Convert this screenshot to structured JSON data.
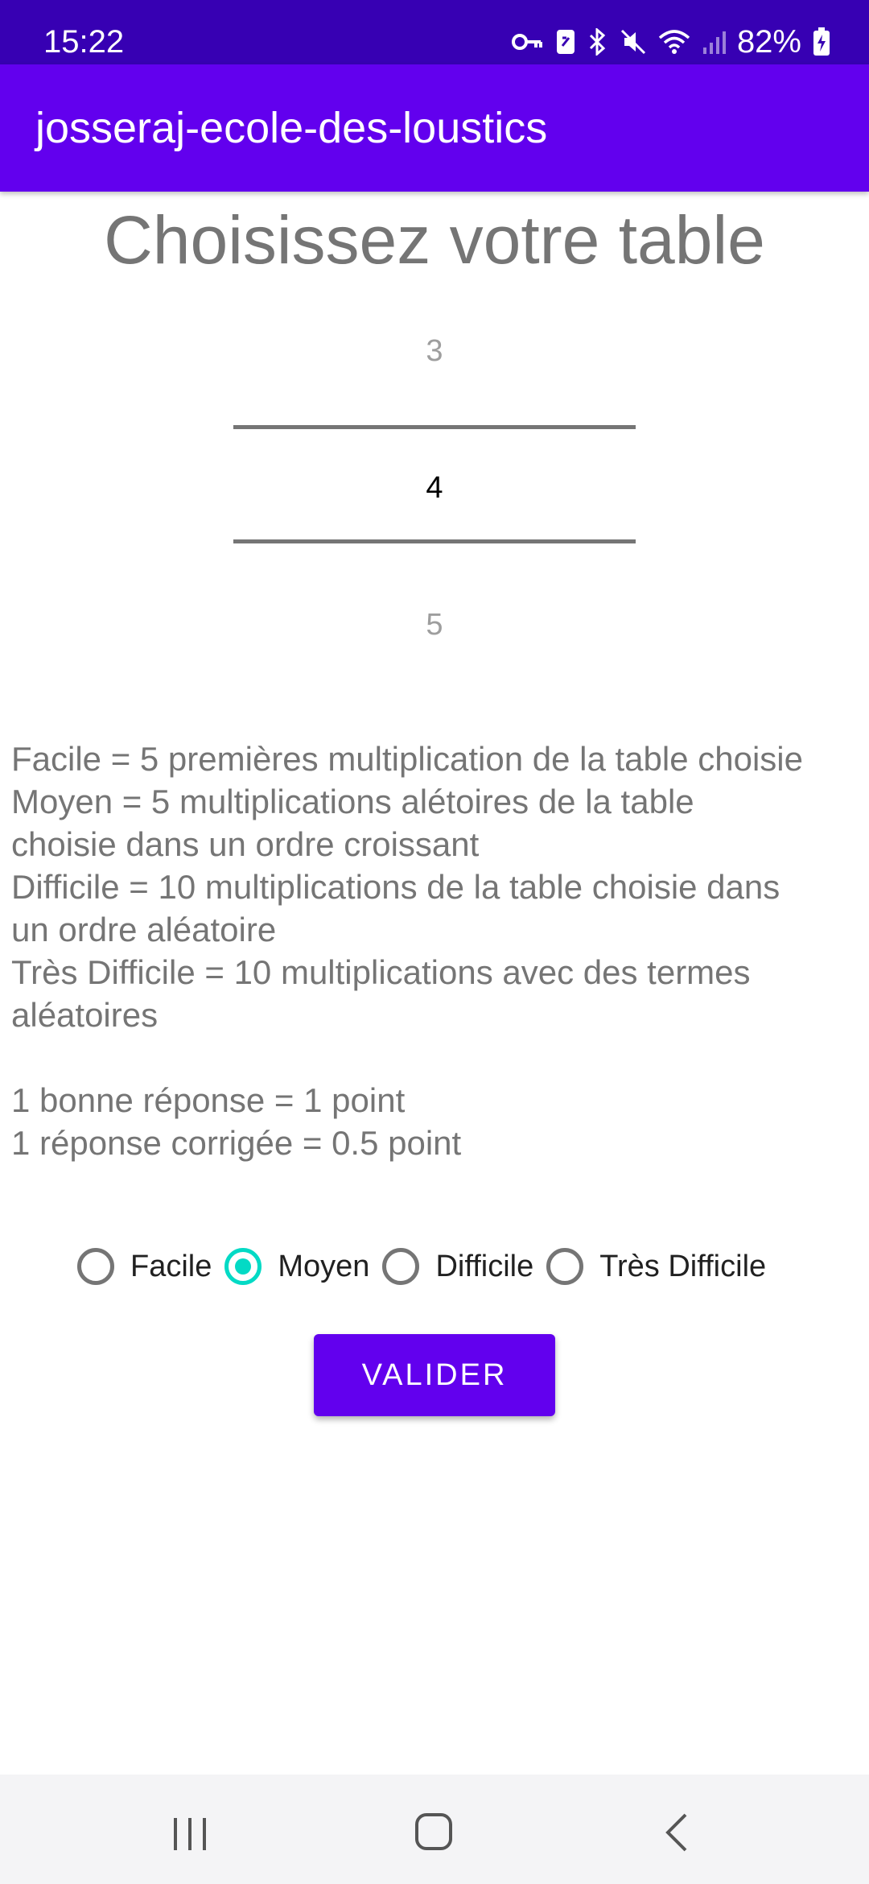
{
  "status_bar": {
    "time": "15:22",
    "battery": "82%",
    "icons": [
      "key-icon",
      "data-saver-icon",
      "bluetooth-icon",
      "mute-icon",
      "wifi-icon",
      "signal-icon",
      "battery-charging-icon"
    ]
  },
  "app_bar": {
    "title": "josseraj-ecole-des-loustics"
  },
  "main": {
    "heading": "Choisissez votre table",
    "picker": {
      "previous": "3",
      "current": "4",
      "next": "5"
    },
    "description_lines": [
      "Facile = 5 premières multiplication de la table choisie",
      "Moyen = 5 multiplications alétoires de la table",
      "choisie dans un ordre croissant",
      "Difficile = 10 multiplications de la table choisie dans",
      "un ordre aléatoire",
      "Très Difficile = 10 multiplications avec des termes",
      "aléatoires",
      "",
      "1 bonne réponse = 1 point",
      "1 réponse corrigée = 0.5 point"
    ],
    "difficulty": {
      "options": [
        "Facile",
        "Moyen",
        "Difficile",
        "Très Difficile"
      ],
      "selected": "Moyen"
    },
    "validate_label": "VALIDER"
  },
  "nav_bar": {
    "buttons": [
      "recent-apps-icon",
      "home-icon",
      "back-icon"
    ]
  },
  "colors": {
    "status_bar": "#3700b3",
    "primary": "#6200ee",
    "accent": "#03dac5",
    "text_secondary": "#757575"
  }
}
